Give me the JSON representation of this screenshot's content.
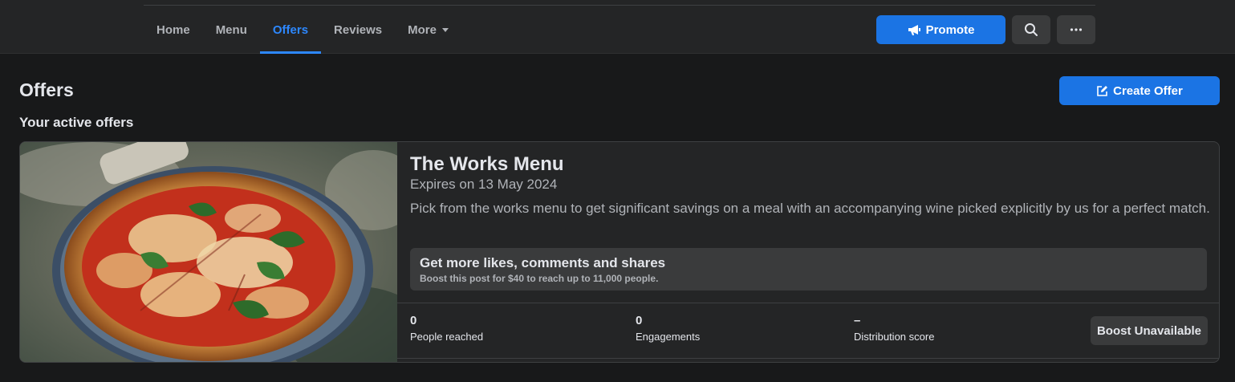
{
  "nav": {
    "tabs": [
      {
        "label": "Home"
      },
      {
        "label": "Menu"
      },
      {
        "label": "Offers"
      },
      {
        "label": "Reviews"
      },
      {
        "label": "More"
      }
    ],
    "active_tab": "Offers",
    "promote_label": "Promote",
    "search_icon": "search-icon",
    "more_icon": "ellipsis-icon"
  },
  "page": {
    "title": "Offers",
    "create_offer_label": "Create Offer",
    "subtitle": "Your active offers"
  },
  "offer": {
    "image": "pizza-margherita-photo",
    "title": "The Works Menu",
    "expiry": "Expires on 13 May 2024",
    "description": "Pick from the works menu to get significant savings on a meal with an accompanying wine picked explicitly by us for a perfect match.",
    "boost": {
      "title": "Get more likes, comments and shares",
      "subtitle": "Boost this post for $40 to reach up to 11,000 people."
    },
    "stats": [
      {
        "value": "0",
        "label": "People reached"
      },
      {
        "value": "0",
        "label": "Engagements"
      },
      {
        "value": "–",
        "label": "Distribution score"
      }
    ],
    "boost_button_label": "Boost Unavailable"
  },
  "colors": {
    "accent": "#1b74e4",
    "active_tab": "#2d88ff",
    "background": "#18191a",
    "surface": "#242526"
  }
}
